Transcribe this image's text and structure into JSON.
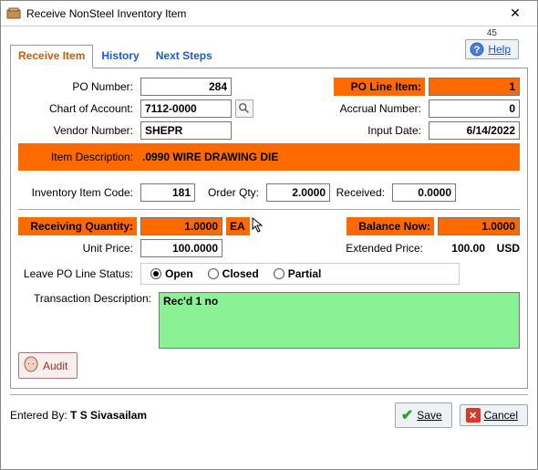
{
  "window": {
    "title": "Receive NonSteel Inventory Item",
    "topRightNum": "45"
  },
  "help": {
    "label": "Help"
  },
  "tabs": {
    "receive": "Receive Item",
    "history": "History",
    "next": "Next Steps"
  },
  "fields": {
    "poNumberLabel": "PO Number:",
    "poNumber": "284",
    "poLineItemLabel": "PO Line Item:",
    "poLineItem": "1",
    "chartLabel": "Chart of Account:",
    "chart": "7112-0000",
    "accrualLabel": "Accrual Number:",
    "accrual": "0",
    "vendorLabel": "Vendor Number:",
    "vendor": "SHEPR",
    "inputDateLabel": "Input Date:",
    "inputDate": "6/14/2022",
    "itemDescLabel": "Item Description:",
    "itemDesc": ".0990 WIRE DRAWING DIE",
    "invCodeLabel": "Inventory Item Code:",
    "invCode": "181",
    "orderQtyLabel": "Order Qty:",
    "orderQty": "2.0000",
    "receivedLabel": "Received:",
    "received": "0.0000",
    "recvQtyLabel": "Receiving Quantity:",
    "recvQty": "1.0000",
    "recvQtyUnit": "EA",
    "balanceLabel": "Balance Now:",
    "balance": "1.0000",
    "unitPriceLabel": "Unit Price:",
    "unitPrice": "100.0000",
    "extPriceLabel": "Extended Price:",
    "extPrice": "100.00",
    "extPriceCur": "USD",
    "leaveStatusLabel": "Leave PO Line Status:",
    "statusOpen": "Open",
    "statusClosed": "Closed",
    "statusPartial": "Partial",
    "txnDescLabel": "Transaction Description:",
    "txnDesc": "Rec'd 1 no"
  },
  "buttons": {
    "audit": "Audit",
    "save": "Save",
    "cancel": "Cancel"
  },
  "footer": {
    "enteredByLabel": "Entered By:",
    "enteredBy": "T S Sivasailam"
  }
}
